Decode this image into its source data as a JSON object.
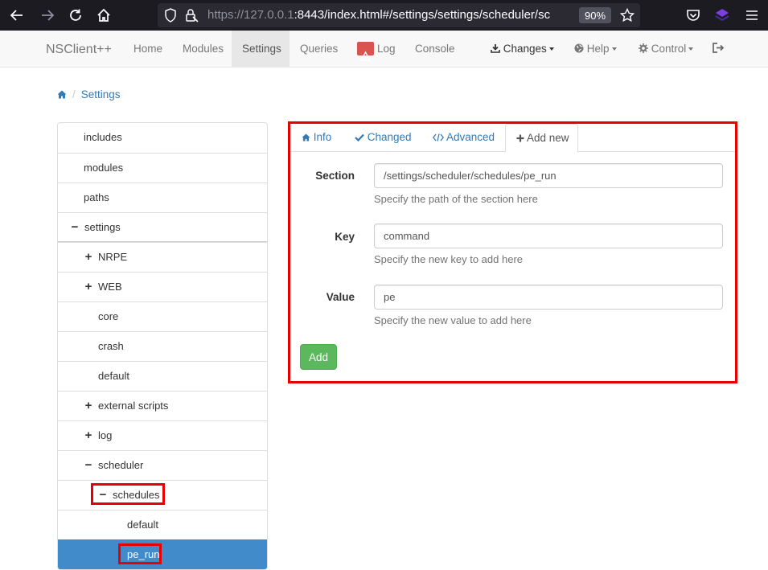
{
  "browser": {
    "url_host": "https://127.0.0.1",
    "url_rest": ":8443/index.html#/settings/settings/scheduler/sc",
    "zoom": "90%"
  },
  "navbar": {
    "brand": "NSClient++",
    "items": [
      {
        "label": "Home"
      },
      {
        "label": "Modules"
      },
      {
        "label": "Settings"
      },
      {
        "label": "Queries"
      },
      {
        "label": "Log"
      },
      {
        "label": "Console"
      },
      {
        "label": "Changes"
      },
      {
        "label": "Help"
      },
      {
        "label": "Control"
      }
    ]
  },
  "breadcrumb": {
    "current": "Settings"
  },
  "tree": {
    "items": [
      {
        "label": "includes"
      },
      {
        "label": "modules"
      },
      {
        "label": "paths"
      },
      {
        "label": "settings",
        "mark": "−"
      },
      {
        "label": "NRPE",
        "mark": "+"
      },
      {
        "label": "WEB",
        "mark": "+"
      },
      {
        "label": "core"
      },
      {
        "label": "crash"
      },
      {
        "label": "default"
      },
      {
        "label": "external scripts",
        "mark": "+"
      },
      {
        "label": "log",
        "mark": "+"
      },
      {
        "label": "scheduler",
        "mark": "−"
      },
      {
        "label": "schedules",
        "mark": "−"
      },
      {
        "label": "default"
      },
      {
        "label": "pe_run"
      }
    ]
  },
  "tabs": [
    {
      "label": "Info"
    },
    {
      "label": "Changed"
    },
    {
      "label": "Advanced"
    },
    {
      "label": "Add new"
    }
  ],
  "form": {
    "section_label": "Section",
    "section_value": "/settings/scheduler/schedules/pe_run",
    "section_help": "Specify the path of the section here",
    "key_label": "Key",
    "key_value": "command",
    "key_help": "Specify the new key to add here",
    "value_label": "Value",
    "value_value": "pe",
    "value_help": "Specify the new value to add here",
    "add_label": "Add"
  },
  "colors": {
    "highlight": "#e60000",
    "selected": "#428bca",
    "link": "#337ab7",
    "add_button": "#5cb85c"
  }
}
